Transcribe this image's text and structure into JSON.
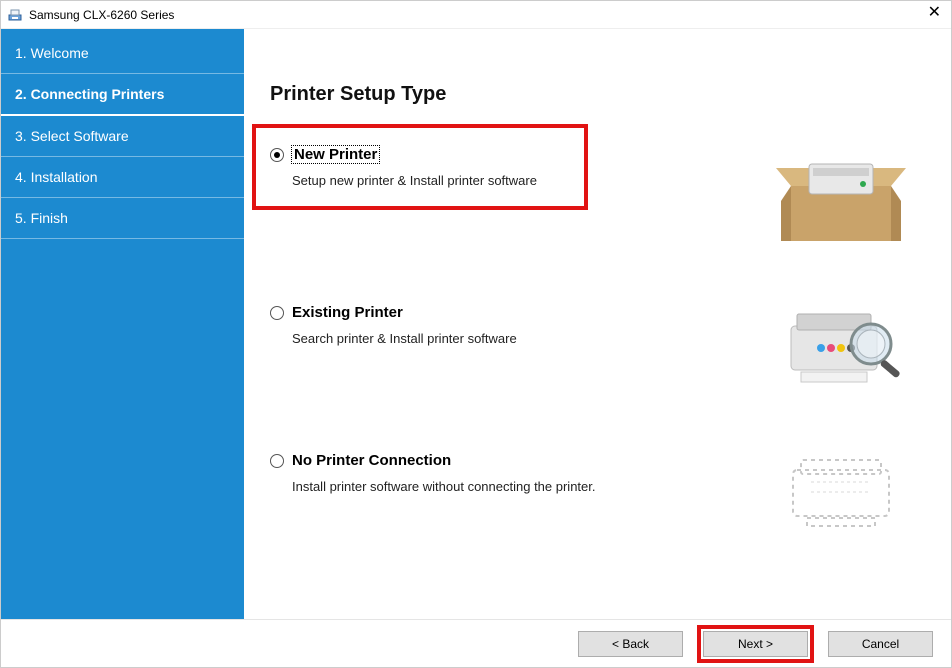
{
  "window": {
    "title": "Samsung CLX-6260 Series"
  },
  "sidebar": {
    "steps": [
      {
        "label": "1. Welcome"
      },
      {
        "label": "2. Connecting Printers"
      },
      {
        "label": "3. Select Software"
      },
      {
        "label": "4. Installation"
      },
      {
        "label": "5. Finish"
      }
    ]
  },
  "main": {
    "heading": "Printer Setup Type",
    "options": [
      {
        "title": "New Printer",
        "desc": "Setup new printer & Install printer software",
        "selected": true
      },
      {
        "title": "Existing Printer",
        "desc": "Search printer & Install printer software",
        "selected": false
      },
      {
        "title": "No Printer Connection",
        "desc": "Install printer software without connecting the printer.",
        "selected": false
      }
    ]
  },
  "footer": {
    "back": "< Back",
    "next": "Next >",
    "cancel": "Cancel"
  }
}
